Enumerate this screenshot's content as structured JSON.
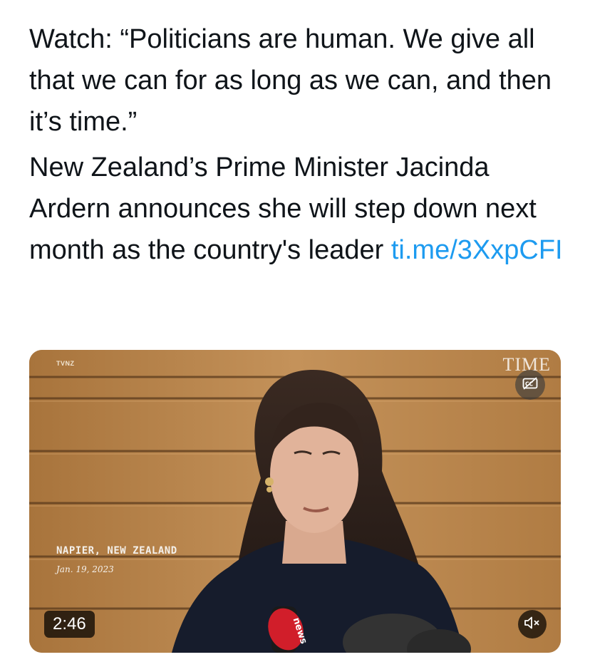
{
  "tweet": {
    "quote_text": "Watch: “Politicians are human. We give all that we can for as long as we can, and then it’s time.”",
    "body_text": "New Zealand’s Prime Minister Jacinda Ardern announces she will step down next month as the country's leader",
    "link": "ti.me/3XxpCFI"
  },
  "video": {
    "broadcaster_bug": "TVNZ",
    "publisher_logo": "TIME",
    "location_caption": "NAPIER, NEW ZEALAND",
    "date_caption": "Jan. 19, 2023",
    "duration": "2:46",
    "icons": {
      "captions": "closed-captions-icon",
      "mute": "speaker-muted-icon"
    }
  },
  "colors": {
    "text": "#0f1419",
    "link": "#1d9bf0",
    "wood_wall": "#b9864a"
  }
}
